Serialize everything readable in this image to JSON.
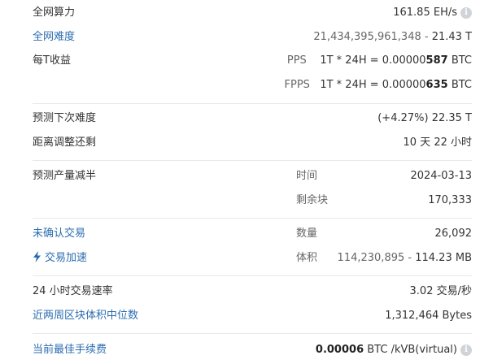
{
  "network_hashrate": {
    "label": "全网算力",
    "value": "161.85 EH/s"
  },
  "network_difficulty": {
    "label": "全网难度",
    "value_raw": "21,434,395,961,348",
    "value_sep": " - ",
    "value_short": "21.43 T"
  },
  "revenue_per_t": {
    "label": "每T收益",
    "pps_label": "PPS",
    "pps_formula": "1T * 24H = ",
    "pps_value_prefix": "0.00000",
    "pps_value_digits": "587",
    "pps_unit": " BTC",
    "fpps_label": "FPPS",
    "fpps_formula": "1T * 24H = ",
    "fpps_value_prefix": "0.00000",
    "fpps_value_digits": "635",
    "fpps_unit": " BTC"
  },
  "next_difficulty": {
    "label": "预测下次难度",
    "change": "(+4.27%)",
    "value": " 22.35 T"
  },
  "time_to_adjust": {
    "label": "距离调整还剩",
    "value": "10 天 22 小时"
  },
  "halving": {
    "label": "预测产量减半",
    "time_label": "时间",
    "time_value": "2024-03-13",
    "blocks_label": "剩余块",
    "blocks_value": "170,333"
  },
  "unconfirmed": {
    "label": "未确认交易",
    "count_label": "数量",
    "count_value": "26,092"
  },
  "tx_accelerate": {
    "label": "交易加速",
    "size_label": "体积",
    "size_raw": "114,230,895",
    "size_sep": " - ",
    "size_short": "114.23 MB"
  },
  "tx_rate_24h": {
    "label": "24 小时交易速率",
    "value": "3.02 交易/秒"
  },
  "median_block_size": {
    "label": "近两周区块体积中位数",
    "value": "1,312,464 Bytes"
  },
  "best_fee": {
    "label": "当前最佳手续费",
    "value_bold": "0.00006",
    "value_rest": " BTC /kVB(virtual)"
  },
  "icons": {
    "info": "info-icon",
    "bolt": "lightning-bolt-icon"
  },
  "colors": {
    "link": "#2b6cb0",
    "text": "#333333",
    "muted": "#666666",
    "divider": "#e6e8eb",
    "info_icon_bg": "#d0d4d8"
  }
}
